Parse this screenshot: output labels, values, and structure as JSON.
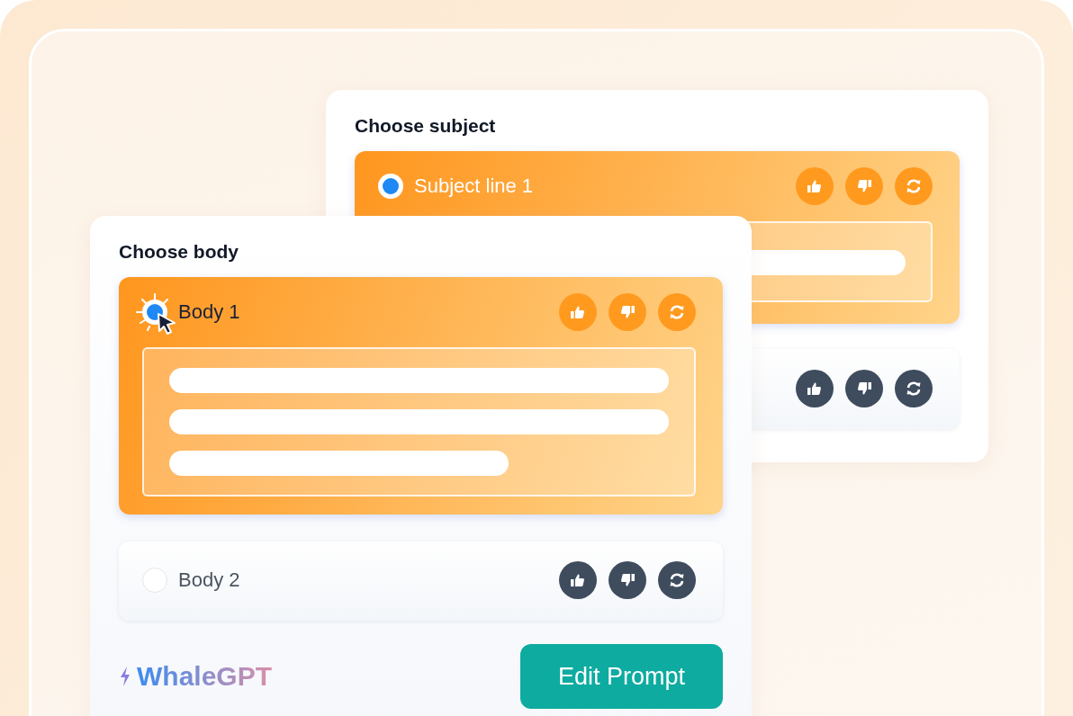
{
  "subject_card": {
    "title": "Choose subject",
    "options": [
      {
        "label": "Subject line 1",
        "selected": true
      },
      {
        "selected": false
      }
    ]
  },
  "body_card": {
    "title": "Choose body",
    "options": [
      {
        "label": "Body 1",
        "selected": true
      },
      {
        "label": "Body 2",
        "selected": false
      }
    ],
    "brand": "WhaleGPT",
    "button": "Edit Prompt"
  }
}
